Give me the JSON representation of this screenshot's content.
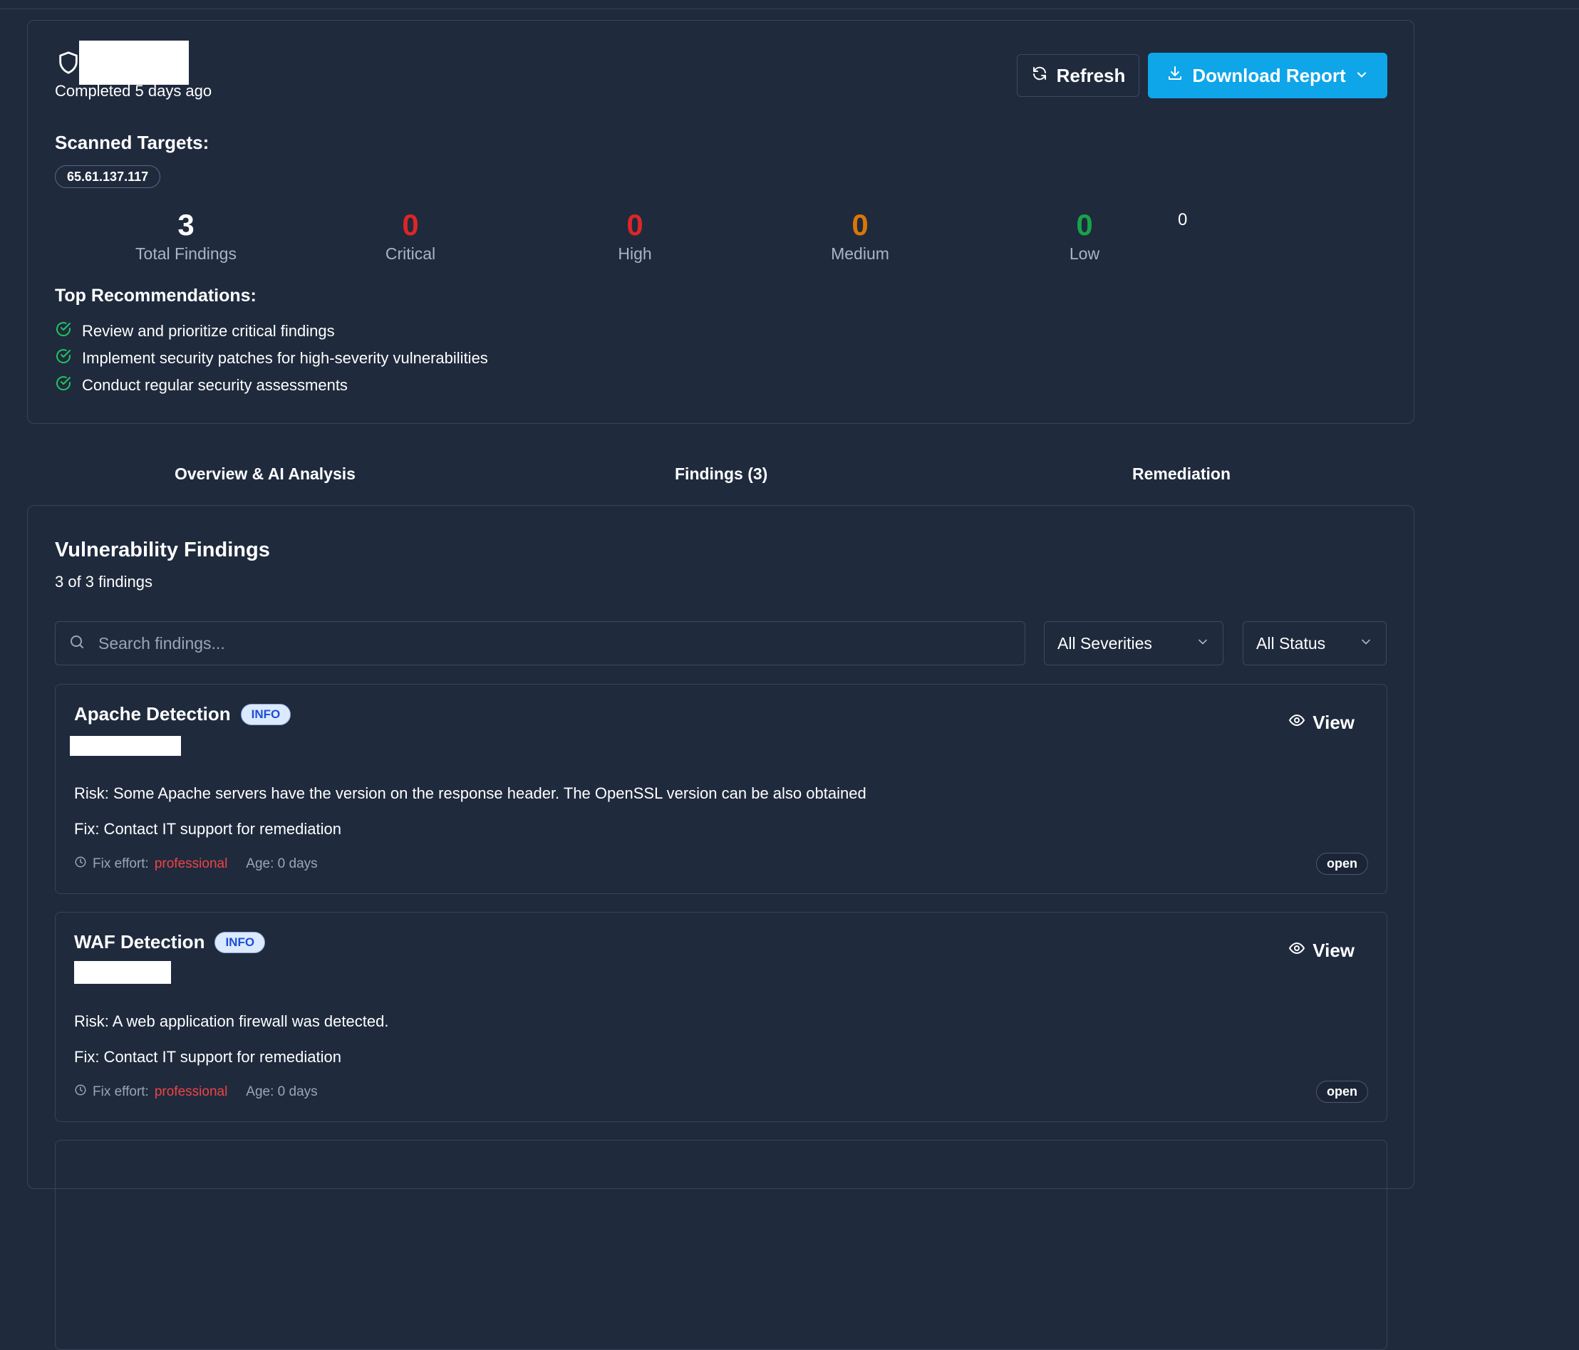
{
  "header": {
    "completed_text": "Completed 5 days ago",
    "refresh_label": "Refresh",
    "download_label": "Download Report"
  },
  "targets": {
    "heading": "Scanned Targets:",
    "items": [
      "65.61.137.117"
    ]
  },
  "stats": {
    "total": {
      "value": "3",
      "label": "Total Findings"
    },
    "critical": {
      "value": "0",
      "label": "Critical",
      "color": "#dc2626"
    },
    "high": {
      "value": "0",
      "label": "High",
      "color": "#dc2626"
    },
    "medium": {
      "value": "0",
      "label": "Medium",
      "color": "#d97706"
    },
    "low": {
      "value": "0",
      "label": "Low",
      "color": "#16a34a"
    },
    "extra": "0"
  },
  "recommendations": {
    "heading": "Top Recommendations:",
    "items": [
      "Review and prioritize critical findings",
      "Implement security patches for high-severity vulnerabilities",
      "Conduct regular security assessments"
    ]
  },
  "tabs": [
    {
      "label": "Overview & AI Analysis"
    },
    {
      "label": "Findings (3)"
    },
    {
      "label": "Remediation"
    }
  ],
  "findings_panel": {
    "title": "Vulnerability Findings",
    "count_text": "3 of 3 findings",
    "search_placeholder": "Search findings...",
    "severity_filter": "All Severities",
    "status_filter": "All Status"
  },
  "findings": [
    {
      "title": "Apache Detection",
      "severity": "INFO",
      "view_label": "View",
      "risk": "Risk: Some Apache servers have the version on the response header. The OpenSSL version can be also obtained",
      "fix": "Fix: Contact IT support for remediation",
      "effort_label": "Fix effort:",
      "effort_value": "professional",
      "age": "Age: 0 days",
      "status": "open"
    },
    {
      "title": "WAF Detection",
      "severity": "INFO",
      "view_label": "View",
      "risk": "Risk: A web application firewall was detected.",
      "fix": "Fix: Contact IT support for remediation",
      "effort_label": "Fix effort:",
      "effort_value": "professional",
      "age": "Age: 0 days",
      "status": "open"
    }
  ],
  "colors": {
    "background": "#1f2a3d",
    "accent": "#0ea5e9",
    "success": "#22c55e"
  }
}
